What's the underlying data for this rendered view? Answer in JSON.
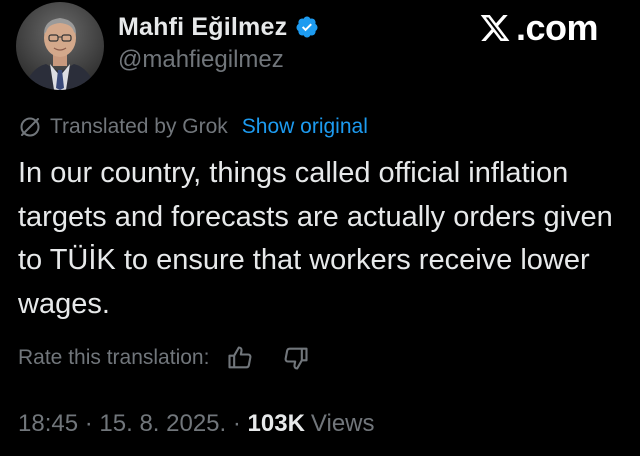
{
  "author": {
    "display_name": "Mahfi Eğilmez",
    "handle": "@mahfiegilmez",
    "verified": true
  },
  "brand": {
    "text": ".com"
  },
  "translation": {
    "label": "Translated by Grok",
    "show_original": "Show original",
    "rate_label": "Rate this translation:"
  },
  "post": {
    "text": "In our country, things called official inflation targets and forecasts are actually orders given to TÜİK to ensure that workers receive lower wages."
  },
  "meta": {
    "time": "18:45",
    "separator": "·",
    "date": "15. 8. 2025.",
    "views_count": "103K",
    "views_label": "Views"
  },
  "icons": {
    "verified": "verified-badge-icon",
    "x_logo": "x-logo-icon",
    "grok": "grok-icon",
    "thumbs_up": "thumbs-up-icon",
    "thumbs_down": "thumbs-down-icon"
  },
  "colors": {
    "background": "#000000",
    "primary_text": "#e7e9ea",
    "secondary_text": "#71767b",
    "link": "#1d9bf0",
    "verified": "#1d9bf0"
  }
}
